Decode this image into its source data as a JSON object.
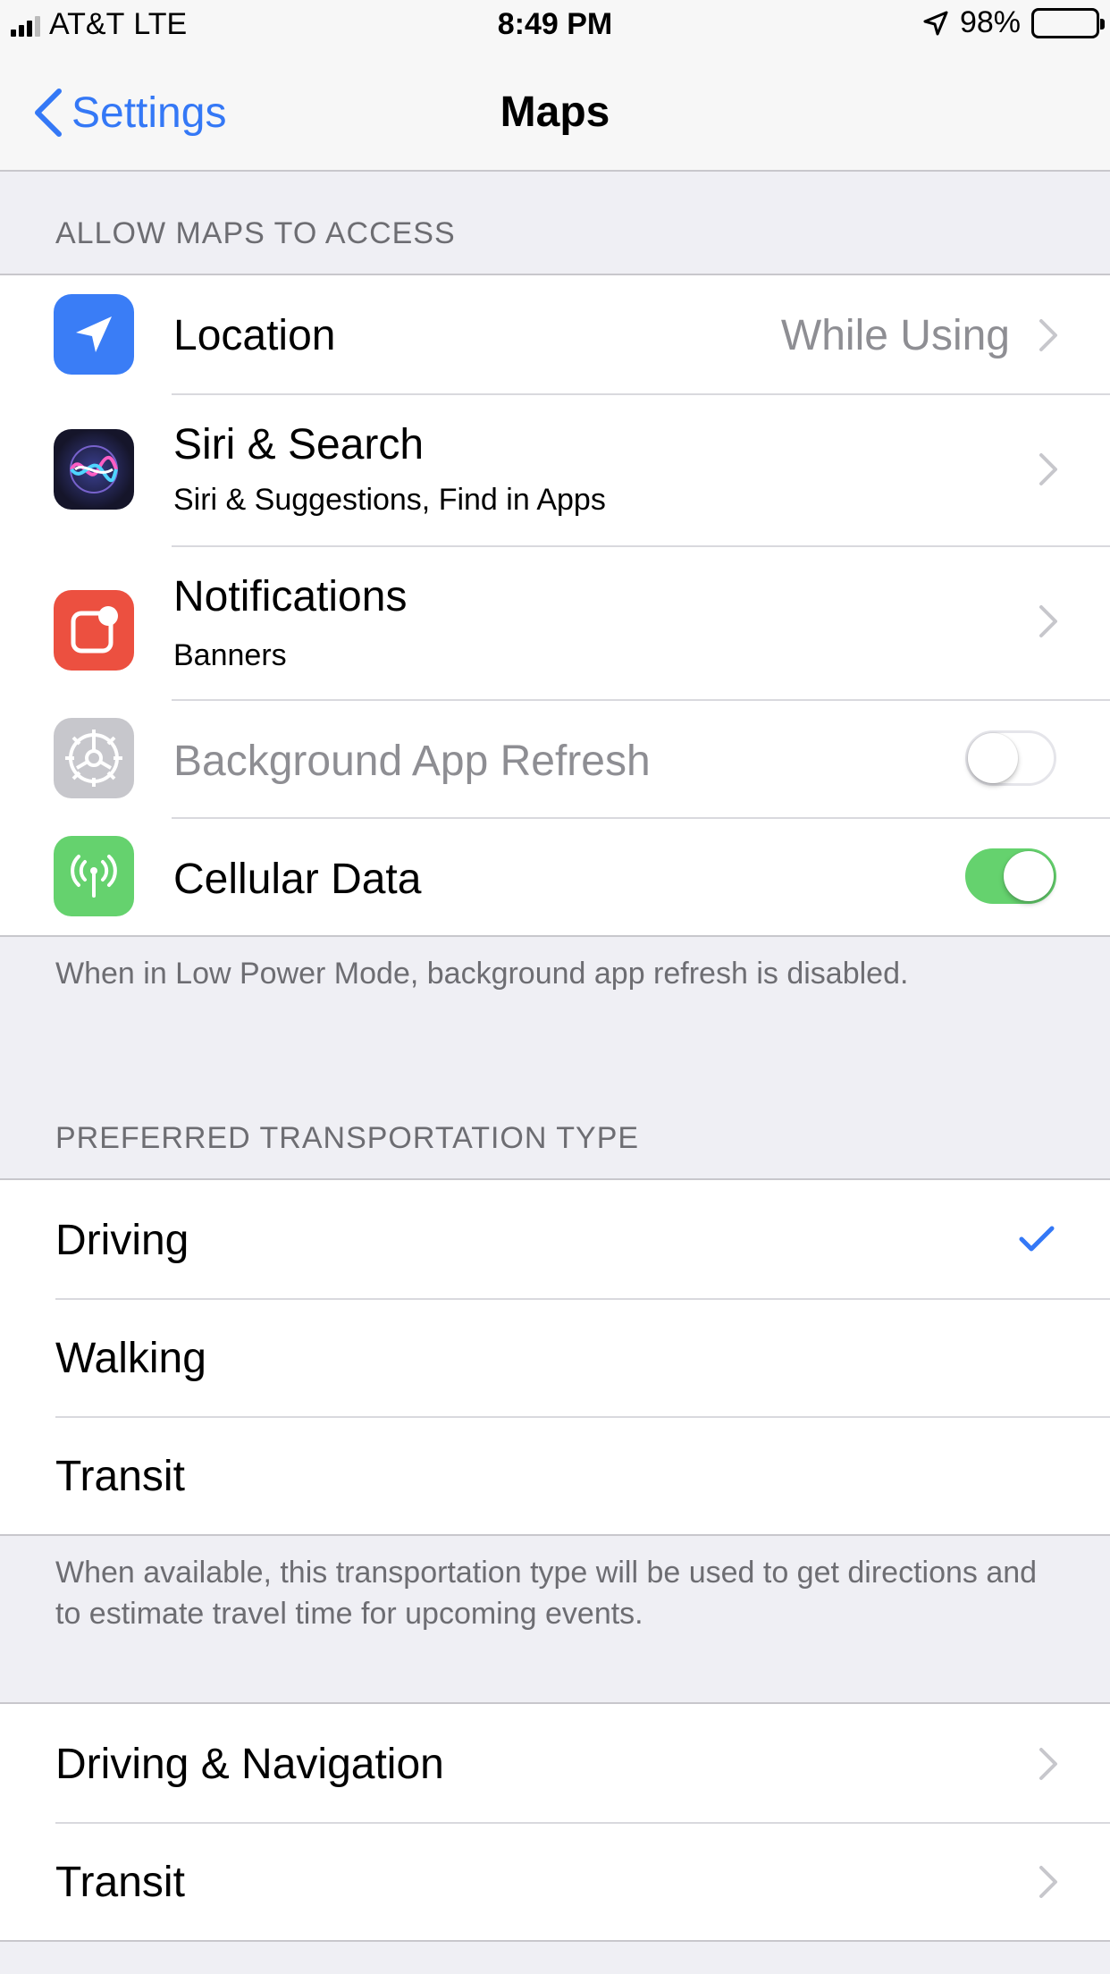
{
  "status_bar": {
    "carrier": "AT&T",
    "network": "LTE",
    "time": "8:49 PM",
    "battery_percent": "98%",
    "battery_color": "#f7cf47"
  },
  "nav": {
    "back_label": "Settings",
    "title": "Maps",
    "accent_color": "#3478f6"
  },
  "access_section": {
    "header": "ALLOW MAPS TO ACCESS",
    "rows": [
      {
        "icon": "location-arrow-icon",
        "label": "Location",
        "value": "While Using"
      },
      {
        "icon": "siri-icon",
        "label": "Siri & Search",
        "subtitle": "Siri & Suggestions, Find in Apps"
      },
      {
        "icon": "notifications-icon",
        "label": "Notifications",
        "subtitle": "Banners"
      },
      {
        "icon": "gear-icon",
        "label": "Background App Refresh",
        "switch": "off",
        "disabled": true
      },
      {
        "icon": "cellular-antenna-icon",
        "label": "Cellular Data",
        "switch": "on"
      }
    ],
    "footer": "When in Low Power Mode, background app refresh is disabled."
  },
  "transport_section": {
    "header": "PREFERRED TRANSPORTATION TYPE",
    "rows": [
      {
        "label": "Driving",
        "selected": true
      },
      {
        "label": "Walking",
        "selected": false
      },
      {
        "label": "Transit",
        "selected": false
      }
    ],
    "footer": "When available, this transportation type will be used to get directions and to estimate travel time for upcoming events."
  },
  "more_section": {
    "rows": [
      {
        "label": "Driving & Navigation"
      },
      {
        "label": "Transit"
      }
    ]
  }
}
